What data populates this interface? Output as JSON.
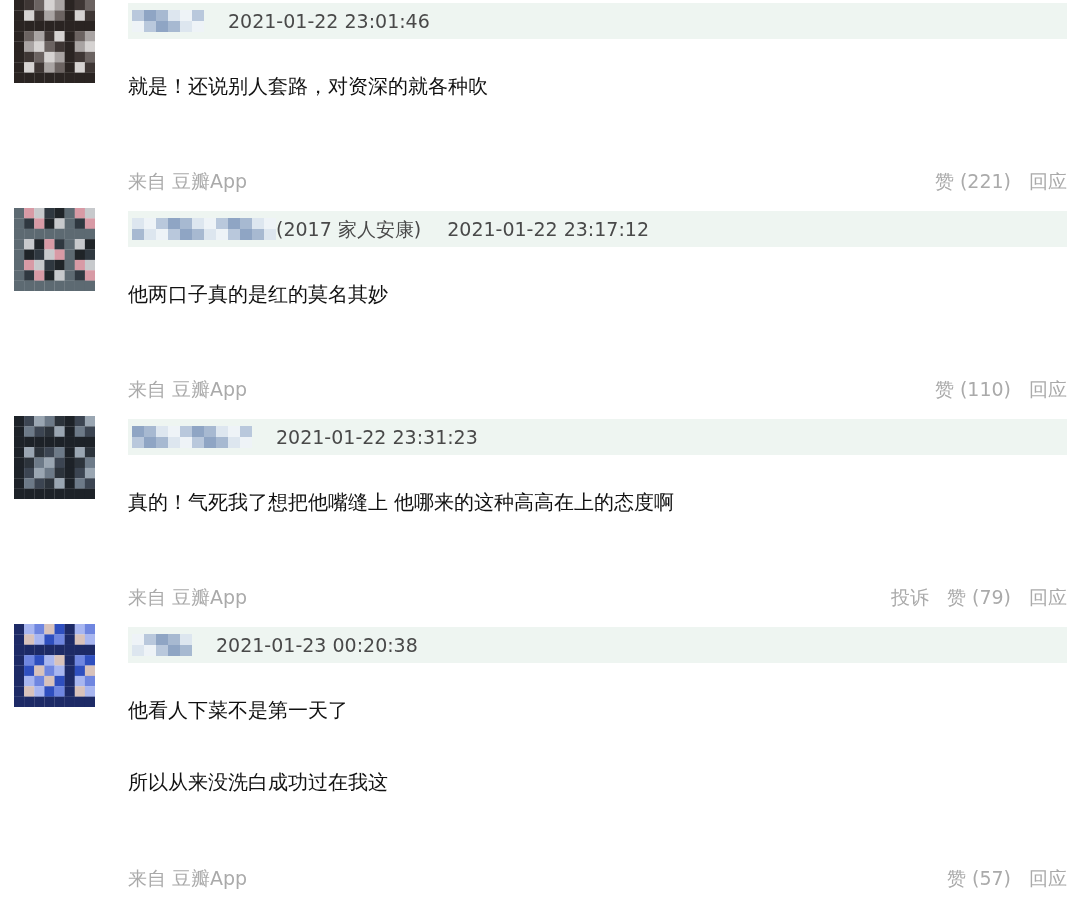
{
  "comments": [
    {
      "time": "2021-01-22 23:01:46",
      "paragraphs": [
        "就是！还说别人套路，对资深的就各种吹"
      ],
      "source": "来自 豆瓣App",
      "actions": [
        "赞 (221)",
        "回应"
      ]
    },
    {
      "user_note": "(2017 家人安康)",
      "time": "2021-01-22 23:17:12",
      "paragraphs": [
        "他两口子真的是红的莫名其妙"
      ],
      "source": "来自 豆瓣App",
      "actions": [
        "赞 (110)",
        "回应"
      ]
    },
    {
      "time": "2021-01-22 23:31:23",
      "paragraphs": [
        "真的！气死我了想把他嘴缝上 他哪来的这种高高在上的态度啊"
      ],
      "source": "来自 豆瓣App",
      "actions": [
        "投诉",
        "赞 (79)",
        "回应"
      ]
    },
    {
      "time": "2021-01-23 00:20:38",
      "paragraphs": [
        "他看人下菜不是第一天了",
        "所以从来没洗白成功过在我这"
      ],
      "source": "来自 豆瓣App",
      "actions": [
        "赞 (57)",
        "回应"
      ]
    }
  ]
}
